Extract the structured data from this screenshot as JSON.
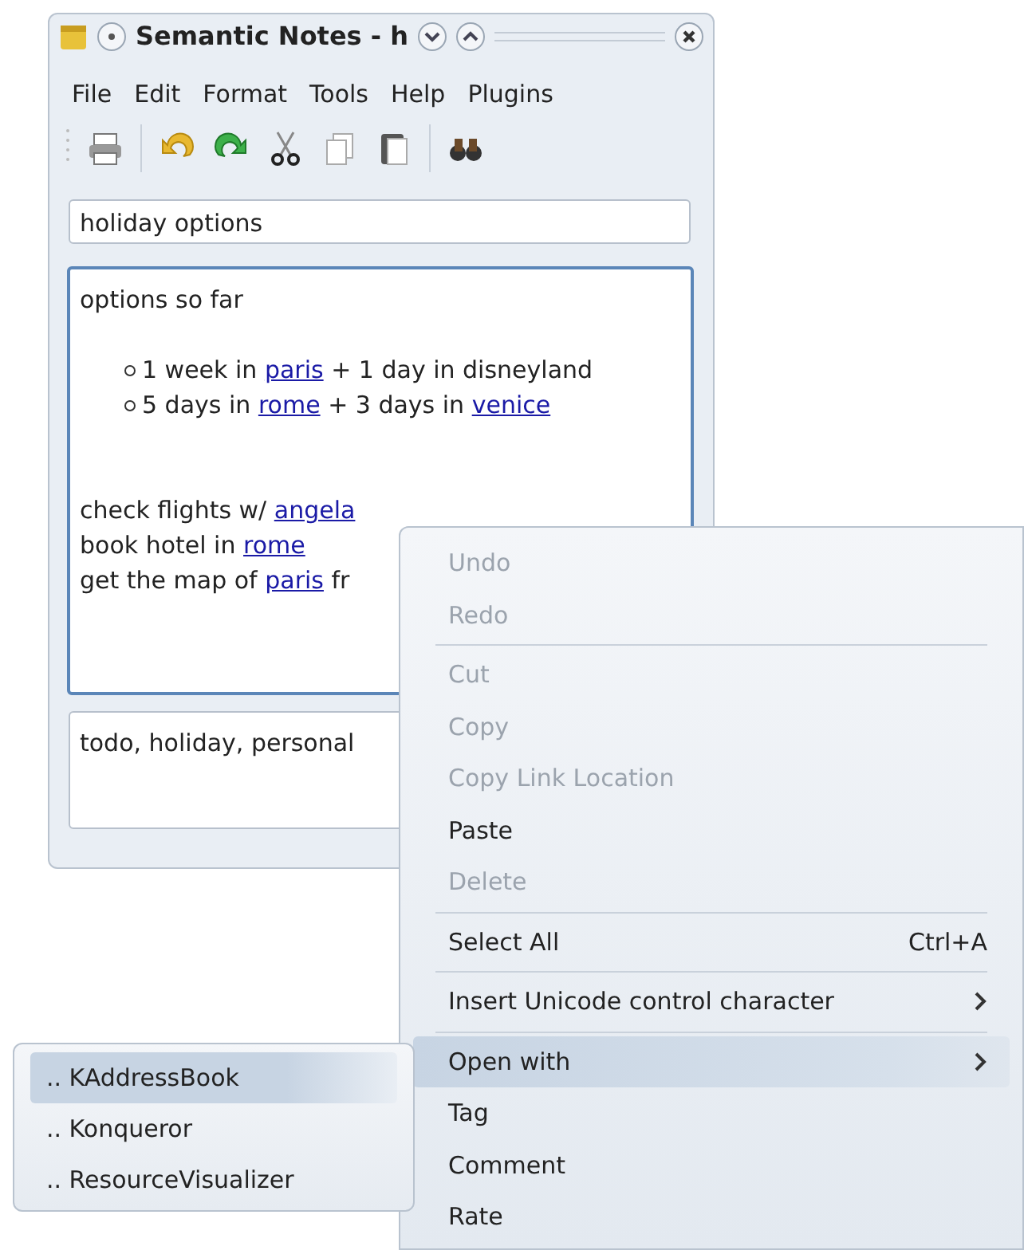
{
  "window": {
    "title": "Semantic Notes - h"
  },
  "menubar": [
    {
      "label": "File"
    },
    {
      "label": "Edit"
    },
    {
      "label": "Format"
    },
    {
      "label": "Tools"
    },
    {
      "label": "Help"
    },
    {
      "label": "Plugins"
    }
  ],
  "toolbar": [
    {
      "kind": "print"
    },
    {
      "kind": "sep"
    },
    {
      "kind": "undo"
    },
    {
      "kind": "redo"
    },
    {
      "kind": "cut"
    },
    {
      "kind": "copy"
    },
    {
      "kind": "paste"
    },
    {
      "kind": "sep"
    },
    {
      "kind": "find"
    }
  ],
  "note_title": {
    "value": "holiday options"
  },
  "note_body": [
    {
      "kind": "line",
      "segments": [
        {
          "text": "options so far",
          "link": false
        }
      ]
    },
    {
      "kind": "gap"
    },
    {
      "kind": "bullet",
      "segments": [
        {
          "text": "1 week in ",
          "link": false
        },
        {
          "text": "paris",
          "link": true
        },
        {
          "text": " + 1 day in disneyland",
          "link": false
        }
      ]
    },
    {
      "kind": "bullet",
      "segments": [
        {
          "text": "5 days in ",
          "link": false
        },
        {
          "text": "rome",
          "link": true
        },
        {
          "text": " + 3 days in ",
          "link": false
        },
        {
          "text": "venice",
          "link": true
        }
      ]
    },
    {
      "kind": "gap"
    },
    {
      "kind": "gap"
    },
    {
      "kind": "line",
      "segments": [
        {
          "text": "check flights w/ ",
          "link": false
        },
        {
          "text": "angela",
          "link": true
        }
      ]
    },
    {
      "kind": "line",
      "segments": [
        {
          "text": "book hotel in ",
          "link": false
        },
        {
          "text": "rome",
          "link": true
        }
      ]
    },
    {
      "kind": "line",
      "segments": [
        {
          "text": "get the map of ",
          "link": false
        },
        {
          "text": "paris",
          "link": true
        },
        {
          "text": " fr",
          "link": false
        }
      ]
    }
  ],
  "tags": {
    "value": "todo, holiday, personal"
  },
  "context_menu": [
    {
      "kind": "item",
      "label": "Undo",
      "disabled": true
    },
    {
      "kind": "item",
      "label": "Redo",
      "disabled": true
    },
    {
      "kind": "sep"
    },
    {
      "kind": "item",
      "label": "Cut",
      "disabled": true
    },
    {
      "kind": "item",
      "label": "Copy",
      "disabled": true
    },
    {
      "kind": "item",
      "label": "Copy Link Location",
      "disabled": true
    },
    {
      "kind": "item",
      "label": "Paste",
      "disabled": false
    },
    {
      "kind": "item",
      "label": "Delete",
      "disabled": true
    },
    {
      "kind": "sep"
    },
    {
      "kind": "item",
      "label": "Select All",
      "shortcut": "Ctrl+A",
      "disabled": false
    },
    {
      "kind": "sep"
    },
    {
      "kind": "submenu",
      "label": "Insert Unicode control character",
      "disabled": false,
      "selected": false
    },
    {
      "kind": "sep"
    },
    {
      "kind": "submenu",
      "label": "Open with",
      "disabled": false,
      "selected": true
    },
    {
      "kind": "item",
      "label": "Tag",
      "disabled": false
    },
    {
      "kind": "item",
      "label": "Comment",
      "disabled": false
    },
    {
      "kind": "item",
      "label": "Rate",
      "disabled": false
    }
  ],
  "submenu": [
    {
      "label": ".. KAddressBook",
      "selected": true
    },
    {
      "label": ".. Konqueror",
      "selected": false
    },
    {
      "label": ".. ResourceVisualizer",
      "selected": false
    }
  ]
}
